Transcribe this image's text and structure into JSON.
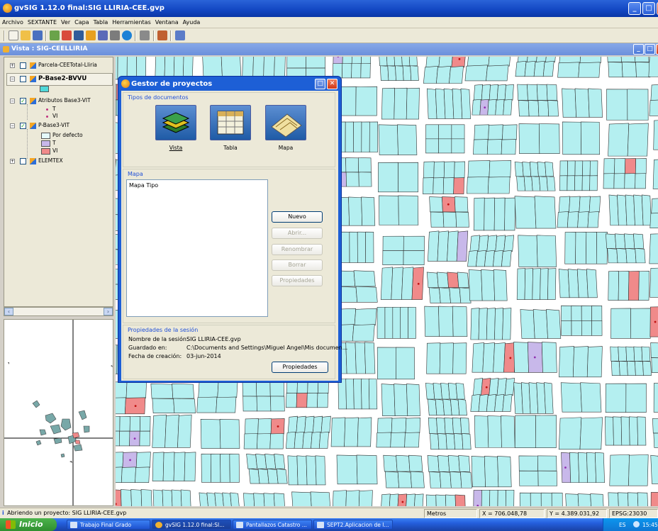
{
  "window": {
    "title": "gvSIG 1.12.0 final:SIG LLIRIA-CEE.gvp",
    "controls": [
      "minimize",
      "maximize",
      "close"
    ]
  },
  "menubar": [
    "Archivo",
    "SEXTANTE",
    "Ver",
    "Capa",
    "Tabla",
    "Herramientas",
    "Ventana",
    "Ayuda"
  ],
  "vista": {
    "title": "Vista : SIG-CEELLIRIA"
  },
  "toc": {
    "layers": [
      {
        "name": "Parcela-CEETotal-Lliria"
      },
      {
        "name": "P-Base2-BVVU"
      },
      {
        "name": "Atributos Base3-VIT",
        "legend": [
          "T",
          "VI"
        ]
      },
      {
        "name": "P-Base3-VIT",
        "legend": [
          "Por defecto",
          "T",
          "VI"
        ]
      },
      {
        "name": "ELEMTEX"
      }
    ]
  },
  "dialog": {
    "title": "Gestor de proyectos",
    "doc_types_label": "Tipos de documentos",
    "doc_types": [
      {
        "label": "Vista",
        "icon": "vista-icon"
      },
      {
        "label": "Tabla",
        "icon": "tabla-icon"
      },
      {
        "label": "Mapa",
        "icon": "mapa-icon"
      }
    ],
    "section_label": "Mapa",
    "list_items": [
      "Mapa Tipo"
    ],
    "buttons": {
      "nuevo": "Nuevo",
      "abrir": "Abrir...",
      "renombrar": "Renombrar",
      "borrar": "Borrar",
      "propiedades": "Propiedades"
    },
    "session": {
      "label": "Propiedades de la sesión",
      "name_label": "Nombre de la sesión:",
      "name_value": "SIG LLIRIA-CEE.gvp",
      "saved_label": "Guardado en:",
      "saved_value": "C:\\Documents and Settings\\Miguel Angel\\Mis documen...",
      "date_label": "Fecha de creación:",
      "date_value": "03-jun-2014",
      "properties_button": "Propiedades"
    }
  },
  "statusbar": {
    "message": "Abriendo un proyecto: SIG LLIRIA-CEE.gvp",
    "units": "Metros",
    "x": "X = 706.048,78",
    "y": "Y = 4.389.031,92",
    "epsg": "EPSG:23030"
  },
  "taskbar": {
    "start": "Inicio",
    "tasks": [
      "Trabajo Final Grado",
      "gvSIG 1.12.0 final:SI...",
      "Pantallazos Catastro ...",
      "SEPT2.Aplicacion de l..."
    ],
    "lang": "ES",
    "clock": "15:45"
  },
  "colors": {
    "parcel_fill": "#b4eff0",
    "parcel_red": "#f08a8a",
    "parcel_purple": "#c8b8ea",
    "title_blue": "#1246c2"
  }
}
